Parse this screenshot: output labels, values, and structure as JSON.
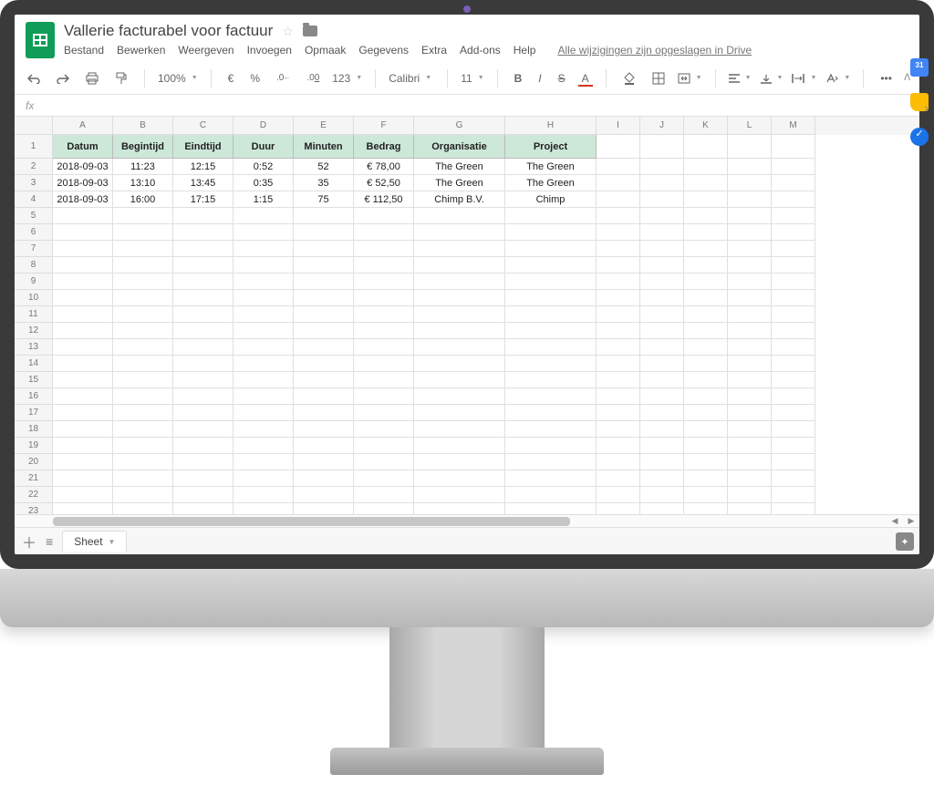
{
  "doc": {
    "title": "Vallerie facturabel voor factuur"
  },
  "menus": [
    "Bestand",
    "Bewerken",
    "Weergeven",
    "Invoegen",
    "Opmaak",
    "Gegevens",
    "Extra",
    "Add-ons",
    "Help"
  ],
  "saveStatus": "Alle wijzigingen zijn opgeslagen in Drive",
  "toolbar": {
    "zoom": "100%",
    "curr": "€",
    "pct": "%",
    "dec0": ".0",
    "dec00": ".00",
    "fmt": "123",
    "font": "Calibri",
    "size": "11",
    "bold": "B",
    "italic": "I",
    "strike": "S",
    "textcolor": "A",
    "more": "•••"
  },
  "fx": {
    "label": "fx"
  },
  "columns": [
    "A",
    "B",
    "C",
    "D",
    "E",
    "F",
    "G",
    "H",
    "I",
    "J",
    "K",
    "L",
    "M"
  ],
  "headers": [
    "Datum",
    "Begintijd",
    "Eindtijd",
    "Duur",
    "Minuten",
    "Bedrag",
    "Organisatie",
    "Project"
  ],
  "rows": [
    {
      "Datum": "2018-09-03",
      "Begintijd": "11:23",
      "Eindtijd": "12:15",
      "Duur": "0:52",
      "Minuten": "52",
      "Bedrag": "€ 78,00",
      "Organisatie": "The Green",
      "Project": "The Green"
    },
    {
      "Datum": "2018-09-03",
      "Begintijd": "13:10",
      "Eindtijd": "13:45",
      "Duur": "0:35",
      "Minuten": "35",
      "Bedrag": "€ 52,50",
      "Organisatie": "The Green",
      "Project": "The Green"
    },
    {
      "Datum": "2018-09-03",
      "Begintijd": "16:00",
      "Eindtijd": "17:15",
      "Duur": "1:15",
      "Minuten": "75",
      "Bedrag": "€ 112,50",
      "Organisatie": "Chimp B.V.",
      "Project": "Chimp"
    }
  ],
  "totalRows": 23,
  "sheet": {
    "tab": "Sheet"
  }
}
